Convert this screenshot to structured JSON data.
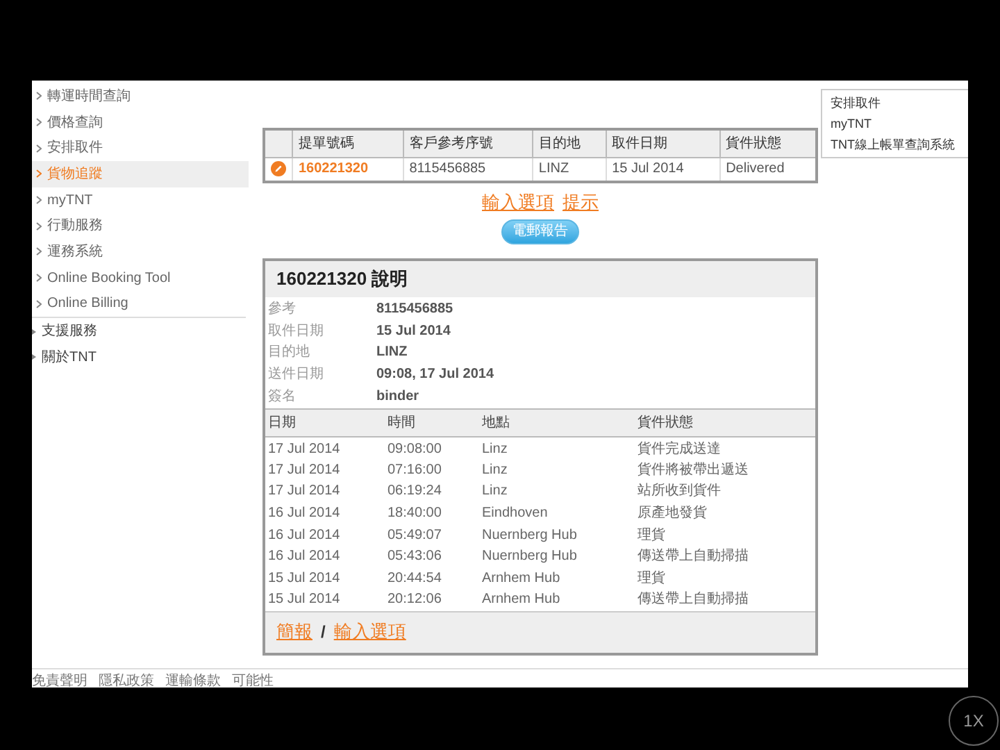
{
  "sidebar": {
    "items": [
      {
        "label": "轉運時間查詢",
        "kind": "sub",
        "selected": false
      },
      {
        "label": "價格查詢",
        "kind": "sub",
        "selected": false
      },
      {
        "label": "安排取件",
        "kind": "sub",
        "selected": false
      },
      {
        "label": "貨物追蹤",
        "kind": "sub",
        "selected": true
      },
      {
        "label": "myTNT",
        "kind": "sub",
        "selected": false
      },
      {
        "label": "行動服務",
        "kind": "sub",
        "selected": false
      },
      {
        "label": "運務系統",
        "kind": "sub",
        "selected": false
      },
      {
        "label": "Online Booking Tool",
        "kind": "sub",
        "selected": false
      },
      {
        "label": "Online Billing",
        "kind": "sub",
        "selected": false
      },
      {
        "label": "支援服務",
        "kind": "section",
        "selected": false
      },
      {
        "label": "關於TNT",
        "kind": "section",
        "selected": false
      }
    ]
  },
  "right_menu": {
    "items": [
      "安排取件",
      "myTNT",
      "TNT線上帳單查詢系統"
    ]
  },
  "shipments": {
    "columns": [
      "提單號碼",
      "客戶參考序號",
      "目的地",
      "取件日期",
      "貨件狀態"
    ],
    "rows": [
      {
        "cells": [
          "160221320",
          "8115456885",
          "LINZ",
          "15 Jul 2014",
          "Delivered"
        ]
      }
    ]
  },
  "links": [
    "輸入選項",
    "提示"
  ],
  "email_button": "電郵報告",
  "details": {
    "title": "160221320 說明",
    "fields": [
      {
        "label": "參考",
        "value": "8115456885"
      },
      {
        "label": "取件日期",
        "value": "15 Jul 2014"
      },
      {
        "label": "目的地",
        "value": "LINZ"
      },
      {
        "label": "送件日期",
        "value": "09:08, 17 Jul 2014"
      },
      {
        "label": "簽名",
        "value": "binder"
      }
    ]
  },
  "events": {
    "columns": [
      "日期",
      "時間",
      "地點",
      "貨件狀態"
    ],
    "rows": [
      [
        "17 Jul 2014",
        "09:08:00",
        "Linz",
        "貨件完成送達"
      ],
      [
        "17 Jul 2014",
        "07:16:00",
        "Linz",
        "貨件將被帶出遞送"
      ],
      [
        "17 Jul 2014",
        "06:19:24",
        "Linz",
        "站所收到貨件"
      ],
      [
        "16 Jul 2014",
        "18:40:00",
        "Eindhoven",
        "原產地發貨"
      ],
      [
        "16 Jul 2014",
        "05:49:07",
        "Nuernberg Hub",
        "理貨"
      ],
      [
        "16 Jul 2014",
        "05:43:06",
        "Nuernberg Hub",
        "傳送帶上自動掃描"
      ],
      [
        "15 Jul 2014",
        "20:44:54",
        "Arnhem Hub",
        "理貨"
      ],
      [
        "15 Jul 2014",
        "20:12:06",
        "Arnhem Hub",
        "傳送帶上自動掃描"
      ]
    ]
  },
  "panel_links": [
    "簡報",
    "/",
    "輸入選項"
  ],
  "footer_links": [
    "免責聲明",
    "隱私政策",
    "運輸條款",
    "可能性"
  ],
  "zoom_button": "1X"
}
